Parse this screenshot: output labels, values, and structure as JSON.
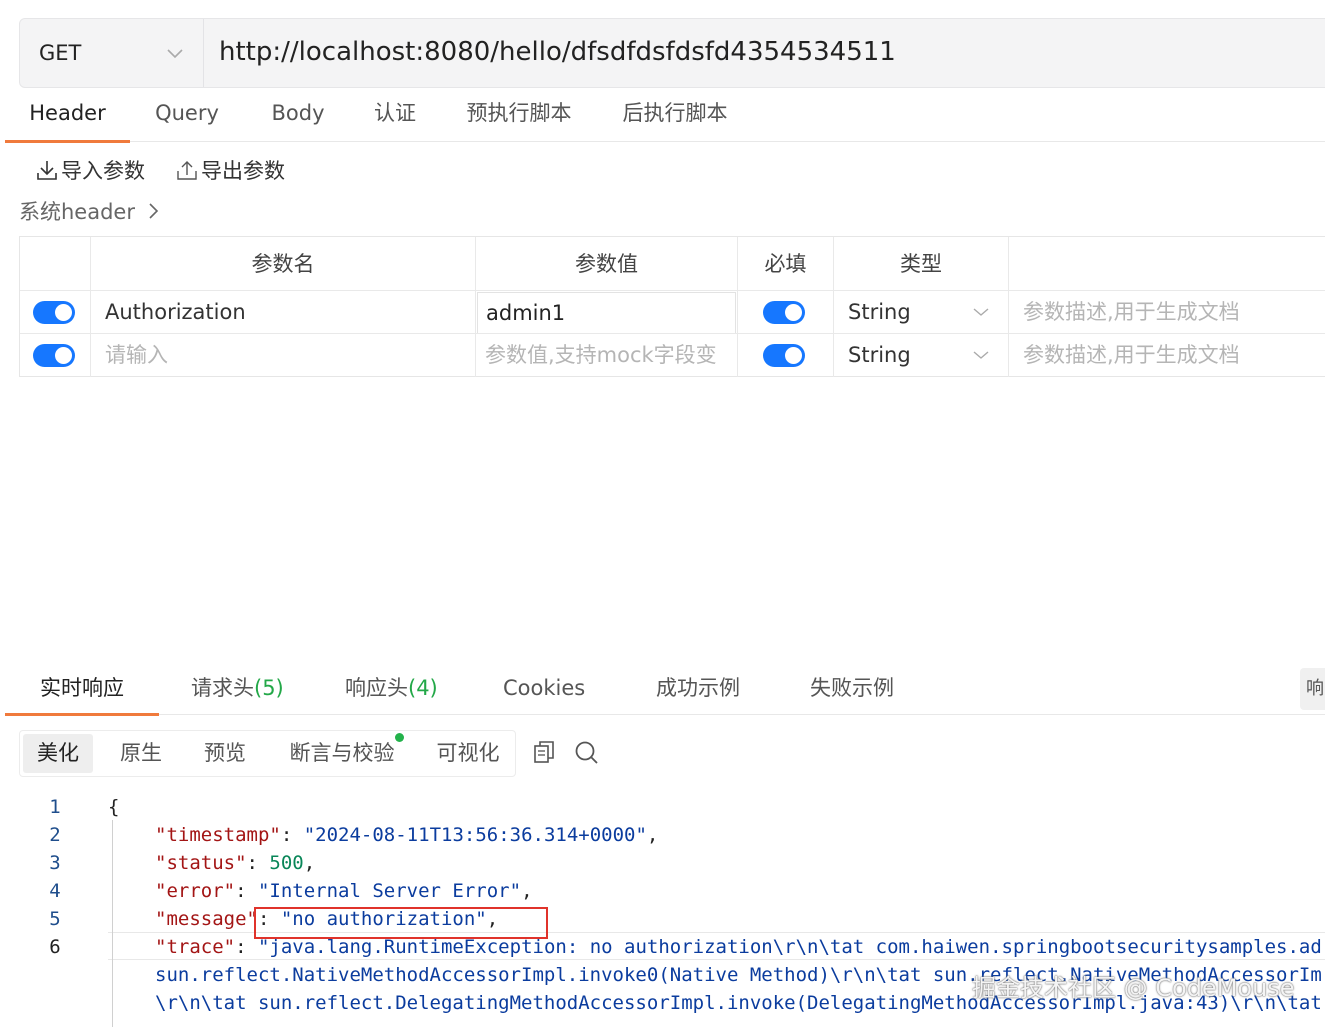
{
  "request": {
    "method": "GET",
    "url": "http://localhost:8080/hello/dfsdfdsfdsfd4354534511"
  },
  "request_tabs": [
    "Header",
    "Query",
    "Body",
    "认证",
    "预执行脚本",
    "后执行脚本"
  ],
  "actions": {
    "import": "导入参数",
    "export": "导出参数"
  },
  "system_header": "系统header",
  "params_table": {
    "columns": [
      "参数名",
      "参数值",
      "必填",
      "类型"
    ],
    "rows": [
      {
        "enabled": true,
        "name": "Authorization",
        "value": "admin1",
        "required": true,
        "type": "String",
        "description_placeholder": "参数描述,用于生成文档"
      },
      {
        "enabled": true,
        "name_placeholder": "请输入",
        "value_placeholder": "参数值,支持mock字段变",
        "required": true,
        "type": "String",
        "description_placeholder": "参数描述,用于生成文档"
      }
    ]
  },
  "response_tabs": [
    {
      "label": "实时响应"
    },
    {
      "label": "请求头",
      "count": "(5)"
    },
    {
      "label": "响应头",
      "count": "(4)"
    },
    {
      "label": "Cookies"
    },
    {
      "label": "成功示例"
    },
    {
      "label": "失败示例"
    }
  ],
  "side_button": "响",
  "view_modes": [
    "美化",
    "原生",
    "预览",
    "断言与校验",
    "可视化"
  ],
  "code": {
    "line_numbers": [
      "1",
      "2",
      "3",
      "4",
      "5",
      "6"
    ],
    "open_brace": "{",
    "fields": {
      "timestamp_key": "\"timestamp\"",
      "timestamp_val": "\"2024-08-11T13:56:36.314+0000\"",
      "status_key": "\"status\"",
      "status_val": "500",
      "error_key": "\"error\"",
      "error_val": "\"Internal Server Error\"",
      "message_key": "\"message\"",
      "message_val": "\"no authorization\"",
      "trace_key": "\"trace\"",
      "trace_val": "\"java.lang.RuntimeException: no authorization\\r\\n\\tat com.haiwen.springbootsecuritysamples.ad"
    },
    "continuation": [
      "sun.reflect.NativeMethodAccessorImpl.invoke0(Native Method)\\r\\n\\tat sun.reflect.NativeMethodAccessorIm",
      "\\r\\n\\tat sun.reflect.DelegatingMethodAccessorImpl.invoke(DelegatingMethodAccessorImpl.java:43)\\r\\n\\tat"
    ]
  },
  "watermark": "掘金技术社区 @ CodeMouse",
  "colors": {
    "accent": "#f07a3c",
    "toggle": "#1677ff",
    "count_green": "#23a848",
    "highlight_box": "#e0332b"
  }
}
